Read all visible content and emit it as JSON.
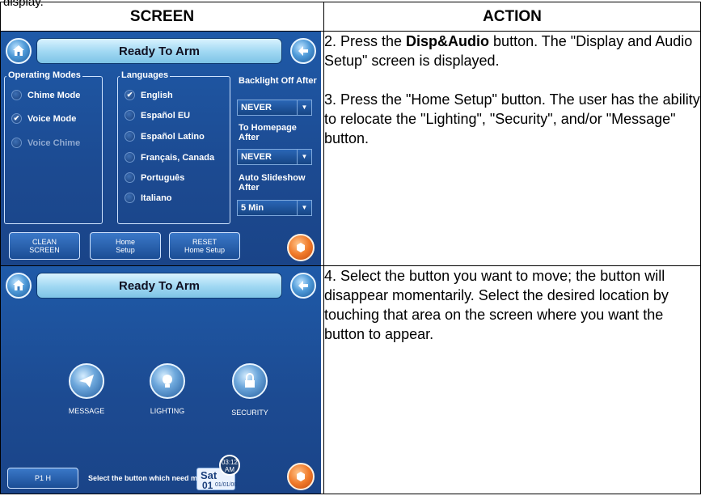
{
  "doc": {
    "top_fragment": "display.",
    "header_screen": "SCREEN",
    "header_action": "ACTION"
  },
  "row1": {
    "screen": {
      "title": "Ready To Arm",
      "operating_modes_title": "Operating Modes",
      "operating_modes": [
        {
          "label": "Chime Mode",
          "checked": false,
          "dim": false
        },
        {
          "label": "Voice Mode",
          "checked": true,
          "dim": false
        },
        {
          "label": "Voice Chime",
          "checked": false,
          "dim": true
        }
      ],
      "languages_title": "Languages",
      "languages": [
        {
          "label": "English",
          "checked": true
        },
        {
          "label": "Español EU",
          "checked": false
        },
        {
          "label": "Español Latino",
          "checked": false
        },
        {
          "label": "Français, Canada",
          "checked": false
        },
        {
          "label": "Português",
          "checked": false
        },
        {
          "label": "Italiano",
          "checked": false
        }
      ],
      "backlight_label": "Backlight Off After",
      "backlight_value": "NEVER",
      "homepage_label": "To Homepage After",
      "homepage_value": "NEVER",
      "slideshow_label": "Auto Slideshow After",
      "slideshow_value": "5 Min",
      "buttons": [
        "CLEAN\nSCREEN",
        "Home\nSetup",
        "RESET\nHome Setup"
      ]
    },
    "action_step2_prefix": "2.  Press the ",
    "action_step2_bold": "Disp&Audio",
    "action_step2_suffix": " button.  The \"Display and Audio Setup\" screen is displayed.",
    "action_step3": "3. Press the \"Home Setup\" button. The user has the ability to relocate the \"Lighting\", \"Security\", and/or \"Message\" button."
  },
  "row2": {
    "screen": {
      "title": "Ready To Arm",
      "icons": [
        {
          "label": "MESSAGE"
        },
        {
          "label": "LIGHTING"
        },
        {
          "label": "SECURITY"
        }
      ],
      "status_button": "P1 H",
      "status_text": "Select the button which need moving",
      "date_day": "Sat",
      "date_num": "01",
      "date_full": "01/01/00",
      "clock_time": "03:12",
      "clock_ampm": "AM"
    },
    "action_step4": "4. Select the button you want to move; the button will disappear momentarily. Select the desired location by touching that area on the screen where you want the button to appear."
  },
  "colors": {
    "screen_bg": "#1d4f98",
    "titlebar": "#a6dbf4",
    "orange_button": "#f07a2a"
  }
}
